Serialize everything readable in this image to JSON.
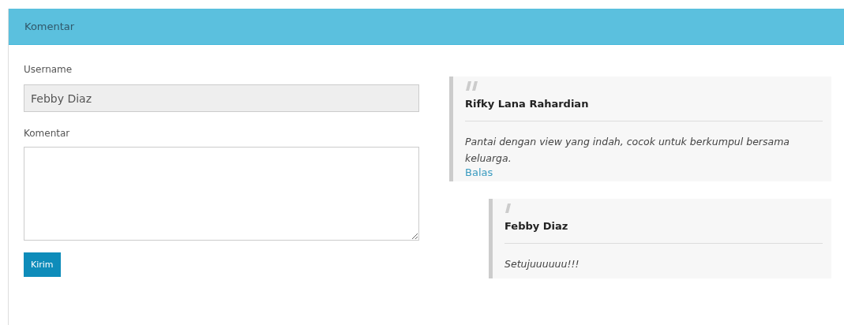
{
  "panel": {
    "title": "Komentar"
  },
  "form": {
    "username_label": "Username",
    "username_value": "Febby Diaz",
    "comment_label": "Komentar",
    "submit": "Kirim"
  },
  "comments": [
    {
      "author": "Rifky Lana Rahardian",
      "text": "Pantai dengan view yang indah, cocok untuk berkumpul bersama keluarga.",
      "reply_link": "Balas",
      "children": [
        {
          "author": "Febby Diaz",
          "text": "Setujuuuuuu!!!"
        }
      ]
    }
  ]
}
